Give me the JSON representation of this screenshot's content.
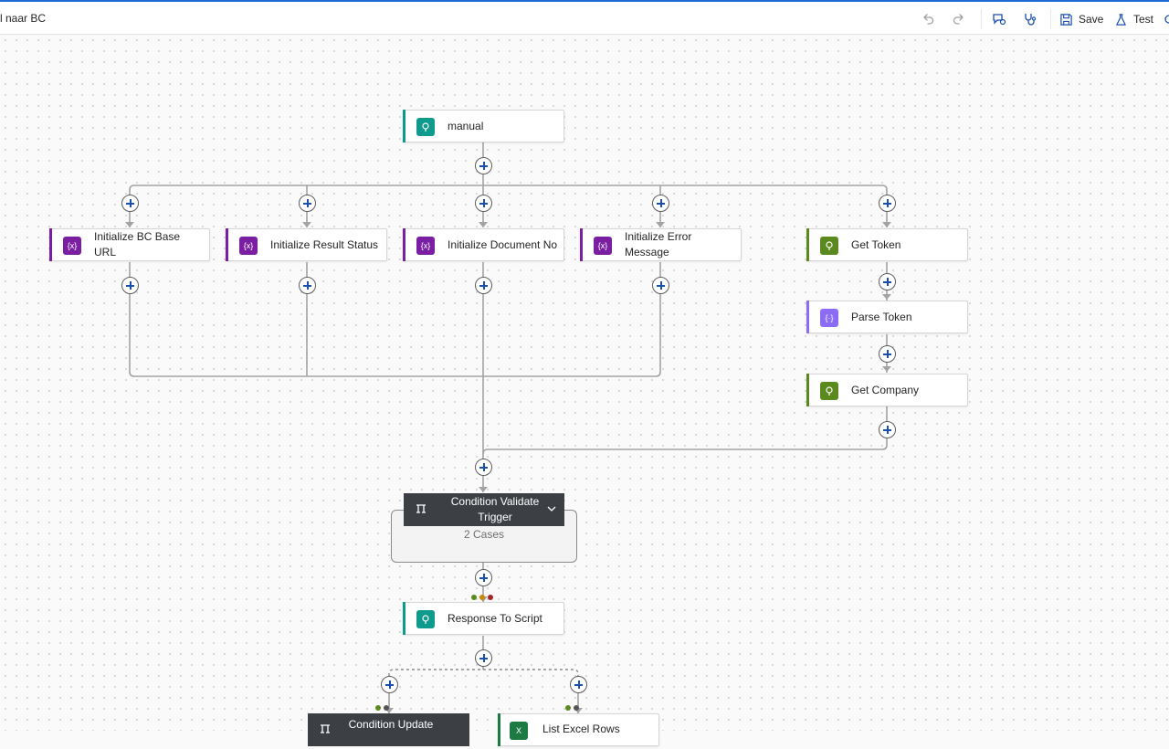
{
  "header": {
    "title": "l naar BC",
    "undo_icon": "undo-icon",
    "redo_icon": "redo-icon",
    "save_label": "Save",
    "test_label": "Test"
  },
  "colors": {
    "trigger_teal": "#0e9a8c",
    "variable_purple": "#7a1fa2",
    "http_green": "#5a8a1e",
    "parse_violet": "#8c6cf5",
    "condition_dark": "#3c4045",
    "excel_green": "#1d7a43"
  },
  "flow": {
    "manual": "manual",
    "init_bc_base_url": "Initialize BC Base URL",
    "init_result_status": "Initialize Result Status",
    "init_document_no": "Initialize Document No",
    "init_error_message": "Initialize Error Message",
    "get_token": "Get Token",
    "parse_token": "Parse Token",
    "get_company": "Get Company",
    "condition_validate_trigger": "Condition Validate Trigger",
    "cases_label": "2 Cases",
    "response_to_script": "Response To Script",
    "condition_update": "Condition Update",
    "list_excel_rows": "List Excel Rows"
  }
}
